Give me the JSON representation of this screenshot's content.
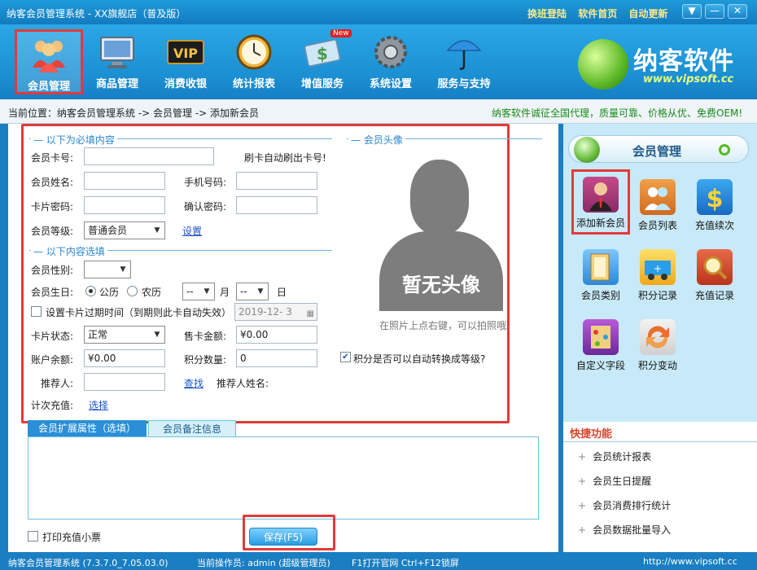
{
  "window": {
    "title": "纳客会员管理系统 - XX旗舰店（普及版）",
    "top_links": [
      "换班登陆",
      "软件首页",
      "自动更新"
    ],
    "controls": [
      "▼",
      "—",
      "✕"
    ]
  },
  "toolbar": {
    "items": [
      {
        "label": "会员管理",
        "icon": "members-icon",
        "active": true
      },
      {
        "label": "商品管理",
        "icon": "monitor-icon"
      },
      {
        "label": "消费收银",
        "icon": "vip-icon"
      },
      {
        "label": "统计报表",
        "icon": "clock-icon"
      },
      {
        "label": "增值服务",
        "icon": "dollar-card-icon",
        "badge": "New"
      },
      {
        "label": "系统设置",
        "icon": "gear-icon"
      },
      {
        "label": "服务与支持",
        "icon": "umbrella-icon"
      }
    ],
    "logo": {
      "name": "纳客软件",
      "url": "www.vipsoft.cc"
    }
  },
  "breadcrumb": {
    "text": "当前位置：纳客会员管理系统 -> 会员管理 -> 添加新会员",
    "promo": "纳客软件诚征全国代理，质量可靠、价格从优、免费OEM!"
  },
  "form": {
    "required_legend": "以下为必填内容",
    "avatar_legend": "会员头像",
    "optional_legend": "以下内容选填",
    "card_no": {
      "label": "会员卡号:",
      "value": "",
      "hint": "刷卡自动刷出卡号!"
    },
    "name": {
      "label": "会员姓名:",
      "value": ""
    },
    "phone": {
      "label": "手机号码:",
      "value": ""
    },
    "password": {
      "label": "卡片密码:",
      "value": ""
    },
    "confirm": {
      "label": "确认密码:",
      "value": ""
    },
    "level": {
      "label": "会员等级:",
      "value": "普通会员",
      "link": "设置"
    },
    "gender": {
      "label": "会员性别:",
      "value": ""
    },
    "birthday": {
      "label": "会员生日:",
      "opt1": "公历",
      "opt2": "农历",
      "month_value": "--",
      "month_unit": "月",
      "day_value": "--",
      "day_unit": "日"
    },
    "expiry": {
      "label": "设置卡片过期时间（到期则此卡自动失效）",
      "date": "2019-12- 3"
    },
    "status": {
      "label": "卡片状态:",
      "value": "正常"
    },
    "price": {
      "label": "售卡金额:",
      "value": "¥0.00"
    },
    "balance": {
      "label": "账户余额:",
      "value": "¥0.00"
    },
    "points": {
      "label": "积分数量:",
      "value": "0"
    },
    "auto_level": {
      "label": "积分是否可以自动转换成等级?",
      "checked": true
    },
    "referrer": {
      "label": "推荐人:",
      "value": "",
      "link": "查找",
      "name_label": "推荐人姓名:"
    },
    "count_recharge": {
      "label": "计次充值:",
      "link": "选择"
    },
    "avatar_text": "暂无头像",
    "avatar_hint": "在照片上点右键，可以拍照哦。",
    "tabs": [
      "会员扩展属性（选填）",
      "会员备注信息"
    ],
    "print_receipt": "打印充值小票",
    "save": "保存(F5)"
  },
  "sidebar": {
    "title": "会员管理",
    "items": [
      {
        "label": "添加新会员",
        "icon": "add-member-icon"
      },
      {
        "label": "会员列表",
        "icon": "member-list-icon"
      },
      {
        "label": "充值续次",
        "icon": "recharge-icon"
      },
      {
        "label": "会员类别",
        "icon": "member-category-icon"
      },
      {
        "label": "积分记录",
        "icon": "points-record-icon"
      },
      {
        "label": "充值记录",
        "icon": "recharge-record-icon"
      },
      {
        "label": "自定义字段",
        "icon": "custom-field-icon"
      },
      {
        "label": "积分变动",
        "icon": "points-change-icon"
      }
    ],
    "quick_title": "快捷功能",
    "quick_items": [
      "会员统计报表",
      "会员生日提醒",
      "会员消费排行统计",
      "会员数据批量导入"
    ]
  },
  "statusbar": {
    "version": "纳客会员管理系统 (7.3.7.0_7.05.03.0)",
    "operator": "当前操作员: admin (超级管理员)",
    "shortcut": "F1打开官网 Ctrl+F12锁屏",
    "url": "http://www.vipsoft.cc"
  }
}
